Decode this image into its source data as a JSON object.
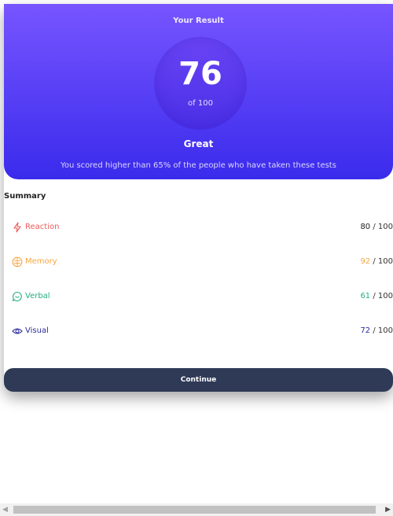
{
  "result": {
    "title": "Your Result",
    "score": "76",
    "score_max": "of 100",
    "grade": "Great",
    "message": "You scored higher than 65% of the people who have taken these tests"
  },
  "summary": {
    "title": "Summary",
    "items": [
      {
        "label": "Reaction",
        "score": "80",
        "max": " / 100",
        "icon": "bolt-icon",
        "color": "#f05a5a",
        "score_color": "#222222"
      },
      {
        "label": "Memory",
        "score": "92",
        "max": " / 100",
        "icon": "brain-icon",
        "color": "#f5a742",
        "score_color": "#f5a742"
      },
      {
        "label": "Verbal",
        "score": "61",
        "max": " / 100",
        "icon": "chat-bubble-icon",
        "color": "#22b07d",
        "score_color": "#22b07d"
      },
      {
        "label": "Visual",
        "score": "72",
        "max": " / 100",
        "icon": "eye-icon",
        "color": "#2c2c9e",
        "score_color": "#2c2c9e"
      }
    ]
  },
  "continue_label": "Continue",
  "colors": {
    "gradient_top": "#7755ff",
    "gradient_bottom": "#3a2bec",
    "button": "#2f3a56"
  }
}
